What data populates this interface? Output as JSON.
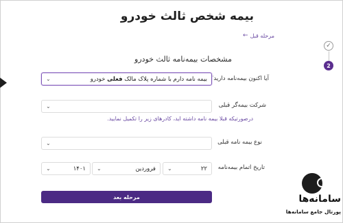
{
  "header": {
    "title": "بیمه شخص ثالث خودرو",
    "prev_link": "مرحله قبل",
    "prev_arrow": "←"
  },
  "steps": {
    "done_mark": "✓",
    "current_number": "2"
  },
  "section": {
    "title": "مشخصات بیمه‌نامه ثالث خودرو"
  },
  "fields": {
    "has_insurance": {
      "label": "آیا اکنون بیمه‌نامه دارید؟",
      "value_prefix": "بیمه نامه دارم با شماره پلاک مالک",
      "value_bold": "فعلی",
      "value_suffix": "خودرو"
    },
    "previous_insurer": {
      "label": "شرکت بیمه‌گر قبلی",
      "value": "",
      "hint": "درصورتیکه قبلا بیمه نامه داشته اید، کادرهای زیر را تکمیل نمایید."
    },
    "previous_type": {
      "label": "نوع بیمه نامه قبلی",
      "value": ""
    },
    "expiry_date": {
      "label": "تاریخ اتمام بیمه‌نامه",
      "day": "۲۲",
      "month": "فروردین",
      "year": "۱۴۰۱"
    }
  },
  "actions": {
    "next_label": "مرحله بعد"
  },
  "brand": {
    "name": "سامانه‌ها",
    "tagline": "پورتال جامع سامانه‌ها"
  },
  "icons": {
    "chevron": "chevron-down-icon",
    "check": "check-icon",
    "logo": "magnifier-logo-icon"
  },
  "colors": {
    "primary": "#4b2a84",
    "accent": "#6b4ba3",
    "step_active": "#5b2e8f"
  }
}
